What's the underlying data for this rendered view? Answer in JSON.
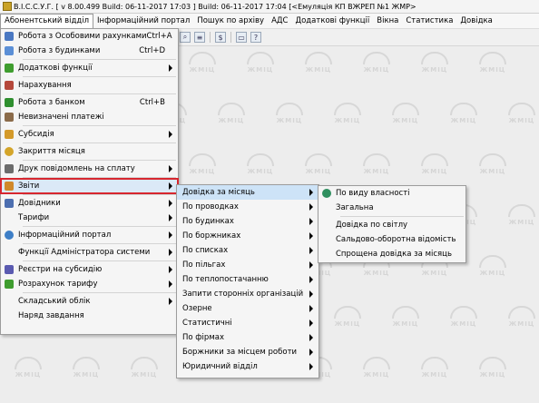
{
  "window": {
    "title": "В.І.С.С.У.Г. [ v 8.00.499 Build: 06-11-2017 17:03 ]  Build: 06-11-2017 17:04 [<Емуляція КП ВЖРЕП №1 ЖМР>"
  },
  "menubar": {
    "items": [
      {
        "label": "Абонентський відділ"
      },
      {
        "label": "Інформаційний портал"
      },
      {
        "label": "Пошук по архіву"
      },
      {
        "label": "АДС"
      },
      {
        "label": "Додаткові функції"
      },
      {
        "label": "Вікна"
      },
      {
        "label": "Статистика"
      },
      {
        "label": "Довідка"
      }
    ]
  },
  "watermark": {
    "text": "ЖМІЦ"
  },
  "main_menu": {
    "items": [
      {
        "label": "Робота з Особовими рахунками",
        "shortcut": "Ctrl+A",
        "icon": "people-icon",
        "icon_color": "#4a78c2"
      },
      {
        "label": "Робота з будинками",
        "shortcut": "Ctrl+D",
        "icon": "house-icon",
        "icon_color": "#5b8fd6"
      },
      {
        "label": "Додаткові функції",
        "icon": "plus-icon",
        "icon_color": "#3f9d2f",
        "submenu": true
      },
      {
        "label": "Нарахування",
        "icon": "calculator-icon",
        "icon_color": "#b5483b"
      },
      {
        "label": "Робота з банком",
        "shortcut": "Ctrl+B",
        "icon": "dollar-icon",
        "icon_color": "#2f8f2f"
      },
      {
        "label": "Невизначені платежі",
        "icon": "payments-icon",
        "icon_color": "#8b6b4a"
      },
      {
        "label": "Субсидія",
        "icon": "hands-icon",
        "icon_color": "#d49a2a",
        "submenu": true
      },
      {
        "label": "Закриття місяця",
        "icon": "lock-icon",
        "icon_color": "#d4a52a"
      },
      {
        "label": "Друк повідомлень на сплату",
        "icon": "printer-icon",
        "icon_color": "#6c6c6c",
        "submenu": true
      },
      {
        "label": "Звіти",
        "icon": "report-icon",
        "icon_color": "#d0892a",
        "submenu": true,
        "highlighted": true
      },
      {
        "label": "Довідники",
        "icon": "book-icon",
        "icon_color": "#4d6fb0",
        "submenu": true
      },
      {
        "label": "Тарифи",
        "submenu": true
      },
      {
        "label": "Інформаційний портал",
        "icon": "globe-icon",
        "icon_color": "#3e7fc7",
        "submenu": true
      },
      {
        "label": "Функції Адміністратора системи",
        "submenu": true
      },
      {
        "label": "Реєстри на субсидію",
        "icon": "register-icon",
        "icon_color": "#5a5ab0",
        "submenu": true
      },
      {
        "label": "Розрахунок тарифу",
        "icon": "tariff-icon",
        "icon_color": "#3f9d2f",
        "submenu": true
      },
      {
        "label": "Складський облік",
        "submenu": true
      },
      {
        "label": "Наряд завдання"
      }
    ]
  },
  "reports_menu": {
    "items": [
      {
        "label": "Довідка за місяць",
        "submenu": true,
        "highlighted": true
      },
      {
        "label": "По проводках",
        "submenu": true
      },
      {
        "label": "По будинках",
        "submenu": true
      },
      {
        "label": "По боржниках",
        "submenu": true
      },
      {
        "label": "По списках",
        "submenu": true
      },
      {
        "label": "По пільгах",
        "submenu": true
      },
      {
        "label": "По теплопостачанню",
        "submenu": true
      },
      {
        "label": "Запити сторонніх організацій",
        "submenu": true
      },
      {
        "label": "Озерне",
        "submenu": true
      },
      {
        "label": "Статистичні",
        "submenu": true
      },
      {
        "label": "По фірмах",
        "submenu": true
      },
      {
        "label": "Боржники за місцем роботи",
        "submenu": true
      },
      {
        "label": "Юридичний відділ",
        "submenu": true
      }
    ]
  },
  "monthly_menu": {
    "items": [
      {
        "label": "По виду власності",
        "icon": "globe-small-icon",
        "icon_color": "#2f8f5f"
      },
      {
        "label": "Загальна"
      },
      {
        "label": "Довідка по світлу"
      },
      {
        "label": "Сальдово-оборотна відомість"
      },
      {
        "label": "Спрощена довідка за місяць"
      }
    ]
  }
}
